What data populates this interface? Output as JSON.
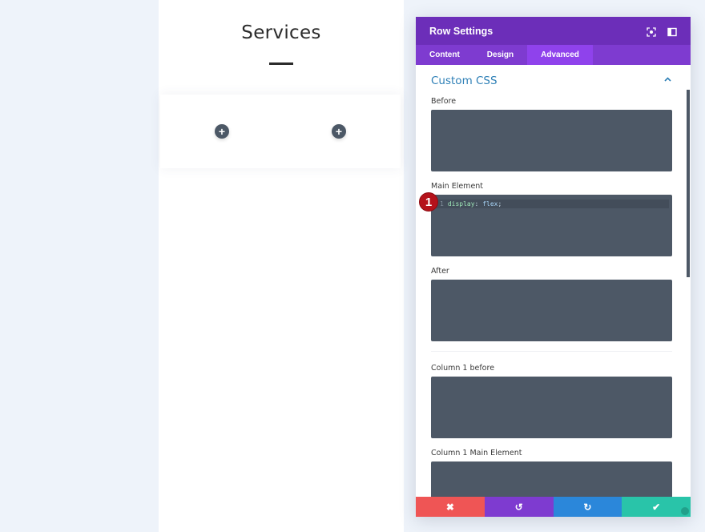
{
  "page": {
    "title": "Services",
    "add_module_icon": "+"
  },
  "modal": {
    "title": "Row Settings",
    "header_icons": [
      "focus-mode-icon",
      "sidebar-toggle-icon"
    ],
    "tabs": [
      {
        "label": "Content",
        "active": false
      },
      {
        "label": "Design",
        "active": false
      },
      {
        "label": "Advanced",
        "active": true
      }
    ],
    "section": {
      "title": "Custom CSS",
      "expanded": true
    },
    "fields": [
      {
        "label": "Before",
        "code": ""
      },
      {
        "label": "Main Element",
        "code_line_number": "1",
        "code_property": "display",
        "code_colon": ":",
        "code_value": "flex",
        "code_semicolon": ";"
      },
      {
        "label": "After",
        "code": ""
      },
      {
        "label": "Column 1 before",
        "code": ""
      },
      {
        "label": "Column 1 Main Element",
        "code": ""
      }
    ],
    "footer": {
      "cancel_icon": "✖",
      "undo_icon": "↺",
      "redo_icon": "↻",
      "save_icon": "✔"
    }
  },
  "annotation": {
    "badge_number": "1"
  },
  "colors": {
    "header": "#6c2eb9",
    "tabs": "#7e3bd0",
    "active_tab": "#8f42ec",
    "section_title": "#2d7fb6",
    "code_bg": "#4d5866",
    "cancel": "#ef5555",
    "undo": "#7e3bd0",
    "redo": "#2b87da",
    "save": "#29c4a9",
    "badge": "#b5121b"
  }
}
